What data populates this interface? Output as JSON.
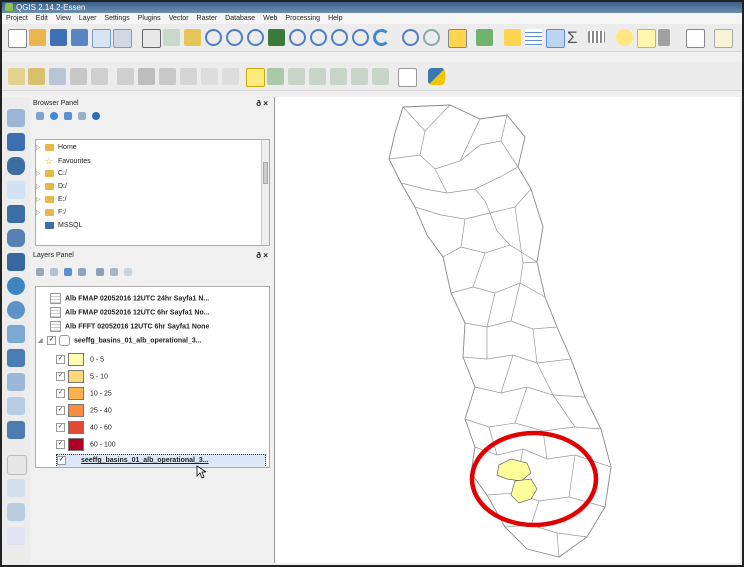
{
  "window": {
    "title": "QGIS 2.14.2-Essen"
  },
  "menu": [
    "Project",
    "Edit",
    "View",
    "Layer",
    "Settings",
    "Plugins",
    "Vector",
    "Raster",
    "Database",
    "Web",
    "Processing",
    "Help"
  ],
  "browser_panel": {
    "title": "Browser Panel",
    "items": [
      "Home",
      "Favourites",
      "C:/",
      "D:/",
      "E:/",
      "F:/",
      "MSSQL"
    ]
  },
  "layers_panel": {
    "title": "Layers Panel",
    "layers": [
      "Alb FMAP 02052016 12UTC 24hr Sayfa1 N...",
      "Alb FMAP 02052016 12UTC 6hr Sayfa1 No...",
      "Alb FFFT 02052016 12UTC 6hr Sayfa1 None",
      "seeffg_basins_01_alb_operational_3..."
    ],
    "classes": [
      {
        "label": "0 - 5",
        "color": "#ffffb2"
      },
      {
        "label": "5 - 10",
        "color": "#fed976"
      },
      {
        "label": "10 - 25",
        "color": "#feb24c"
      },
      {
        "label": "25 - 40",
        "color": "#fd8d3c"
      },
      {
        "label": "40 - 60",
        "color": "#e34a33"
      },
      {
        "label": "60 - 100",
        "color": "#b10026"
      }
    ],
    "selected_layer": "seeffg_basins_01_alb_operational_3..."
  },
  "map": {
    "highlight_color": "#ffff99",
    "circle_color": "#e00000"
  }
}
